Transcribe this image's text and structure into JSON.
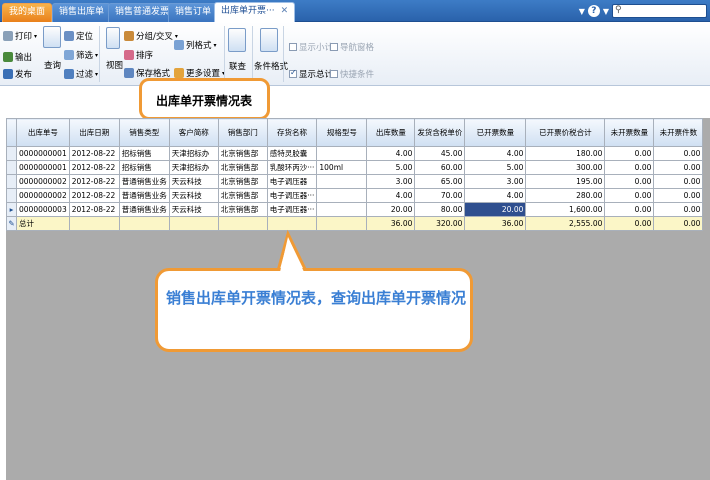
{
  "tabs": [
    {
      "label": "我的桌面",
      "type": "home"
    },
    {
      "label": "销售出库单"
    },
    {
      "label": "销售普通发票"
    },
    {
      "label": "销售订单"
    },
    {
      "label": "出库单开票···",
      "active": true
    }
  ],
  "tab_close": "✕",
  "toolbar": {
    "print": "打印",
    "export": "输出",
    "publish": "发布",
    "query": "查询",
    "locate": "定位",
    "filter": "筛选",
    "filter2": "过滤",
    "view": "视图",
    "group": "分组/交叉",
    "sort": "排序",
    "save_format": "保存格式",
    "column_format": "列格式",
    "more_settings": "更多设置",
    "link_query": "联查",
    "conditional_format": "条件格式",
    "show_subtotal": "显示小计",
    "nav_window": "导航窗格",
    "show_total": "显示总计",
    "quick_condition": "快捷条件"
  },
  "page_title": "出库单开票情况表",
  "table": {
    "columns": [
      "出库单号",
      "出库日期",
      "销售类型",
      "客户简称",
      "销售部门",
      "存货名称",
      "规格型号",
      "出库数量",
      "发货含税单价",
      "已开票数量",
      "已开票价税合计",
      "未开票数量",
      "未开票件数"
    ],
    "rows": [
      [
        "0000000001",
        "2012-08-22",
        "招标销售",
        "天津招标办",
        "北京销售部",
        "感特灵胶囊",
        "",
        "4.00",
        "45.00",
        "4.00",
        "180.00",
        "0.00",
        "0.00"
      ],
      [
        "0000000001",
        "2012-08-22",
        "招标销售",
        "天津招标办",
        "北京销售部",
        "乳酸环丙沙···",
        "100ml",
        "5.00",
        "60.00",
        "5.00",
        "300.00",
        "0.00",
        "0.00"
      ],
      [
        "0000000002",
        "2012-08-22",
        "普通销售业务",
        "天云科技",
        "北京销售部",
        "电子调压器",
        "",
        "3.00",
        "65.00",
        "3.00",
        "195.00",
        "0.00",
        "0.00"
      ],
      [
        "0000000002",
        "2012-08-22",
        "普通销售业务",
        "天云科技",
        "北京销售部",
        "电子调压器···",
        "",
        "4.00",
        "70.00",
        "4.00",
        "280.00",
        "0.00",
        "0.00"
      ],
      [
        "0000000003",
        "2012-08-22",
        "普通销售业务",
        "天云科技",
        "北京销售部",
        "电子调压器···",
        "",
        "20.00",
        "80.00",
        "20.00",
        "1,600.00",
        "0.00",
        "0.00"
      ]
    ],
    "total_row": [
      "总计",
      "",
      "",
      "",
      "",
      "",
      "",
      "36.00",
      "320.00",
      "36.00",
      "2,555.00",
      "0.00",
      "0.00"
    ]
  },
  "callout": "销售出库单开票情况表，查询出库单开票情况",
  "colors": {
    "accent": "#f09a35",
    "callout_text": "#3a7fd4",
    "tabbar": "#2a62ab"
  }
}
